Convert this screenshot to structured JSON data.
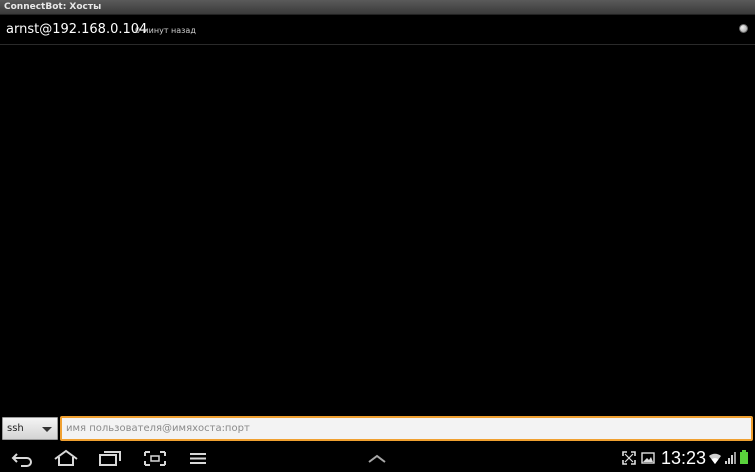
{
  "window": {
    "title": "ConnectBot: Хосты"
  },
  "hosts": [
    {
      "nickname": "arnst@192.168.0.104",
      "last_connect": "0 минут назад",
      "status_icon": "status-dot-icon"
    }
  ],
  "quick_connect": {
    "protocol": "ssh",
    "placeholder": "имя пользователя@имяхоста:порт",
    "value": ""
  },
  "status_bar": {
    "time": "13:23",
    "icons": [
      "screen-rotate-icon",
      "gallery-icon",
      "wifi-icon",
      "signal-icon",
      "battery-icon"
    ]
  },
  "nav_bar": {
    "icons": [
      "back-icon",
      "home-icon",
      "recent-apps-icon",
      "screenshot-icon",
      "menu-icon",
      "expand-up-icon"
    ]
  },
  "colors": {
    "background": "#000000",
    "input_focus": "#f0a030",
    "battery": "#5ad23c"
  }
}
